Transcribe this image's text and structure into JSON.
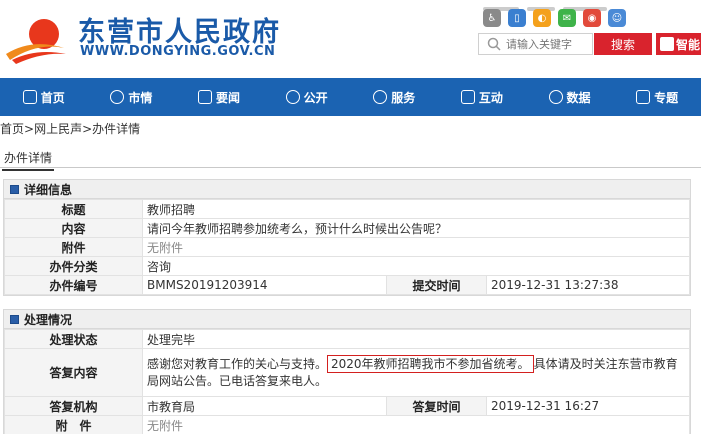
{
  "site": {
    "title": "东营市人民政府",
    "url": "WWW.DONGYING.GOV.CN"
  },
  "search": {
    "placeholder": "请输入关键字",
    "button": "搜索",
    "smart_label": "智能"
  },
  "nav": [
    {
      "label": "首页",
      "icon": "home-icon"
    },
    {
      "label": "市情",
      "icon": "people-icon"
    },
    {
      "label": "要闻",
      "icon": "list-icon"
    },
    {
      "label": "公开",
      "icon": "eye-icon"
    },
    {
      "label": "服务",
      "icon": "heart-icon"
    },
    {
      "label": "互动",
      "icon": "interaction-icon"
    },
    {
      "label": "数据",
      "icon": "data-icon"
    },
    {
      "label": "专题",
      "icon": "document-icon"
    }
  ],
  "breadcrumb": [
    "首页",
    "网上民声",
    "办件详情"
  ],
  "tab": "办件详情",
  "detail": {
    "heading": "详细信息",
    "rows": {
      "title_label": "标题",
      "title_value": "教师招聘",
      "content_label": "内容",
      "content_value": "请问今年教师招聘参加统考么，预计什么时候出公告呢？",
      "attach_label": "附件",
      "attach_value": "无附件",
      "category_label": "办件分类",
      "category_value": "咨询",
      "number_label": "办件编号",
      "number_value": "BMMS20191203914",
      "submit_label": "提交时间",
      "submit_value": "2019-12-31 13:27:38"
    }
  },
  "process": {
    "heading": "处理情况",
    "rows": {
      "status_label": "处理状态",
      "status_value": "处理完毕",
      "reply_label": "答复内容",
      "reply_pre": "感谢您对教育工作的关心与支持。",
      "reply_highlight": "2020年教师招聘我市不参加省统考。",
      "reply_post": "具体请及时关注东营市教育局网站公告。已电话答复来电人。",
      "org_label": "答复机构",
      "org_value": "市教育局",
      "reply_time_label": "答复时间",
      "reply_time_value": "2019-12-31 16:27",
      "attach_label": "附　件",
      "attach_value": "无附件"
    }
  },
  "colors": {
    "brand_blue": "#1b63b2",
    "search_red": "#d9232d",
    "highlight_red": "#d3201f"
  }
}
